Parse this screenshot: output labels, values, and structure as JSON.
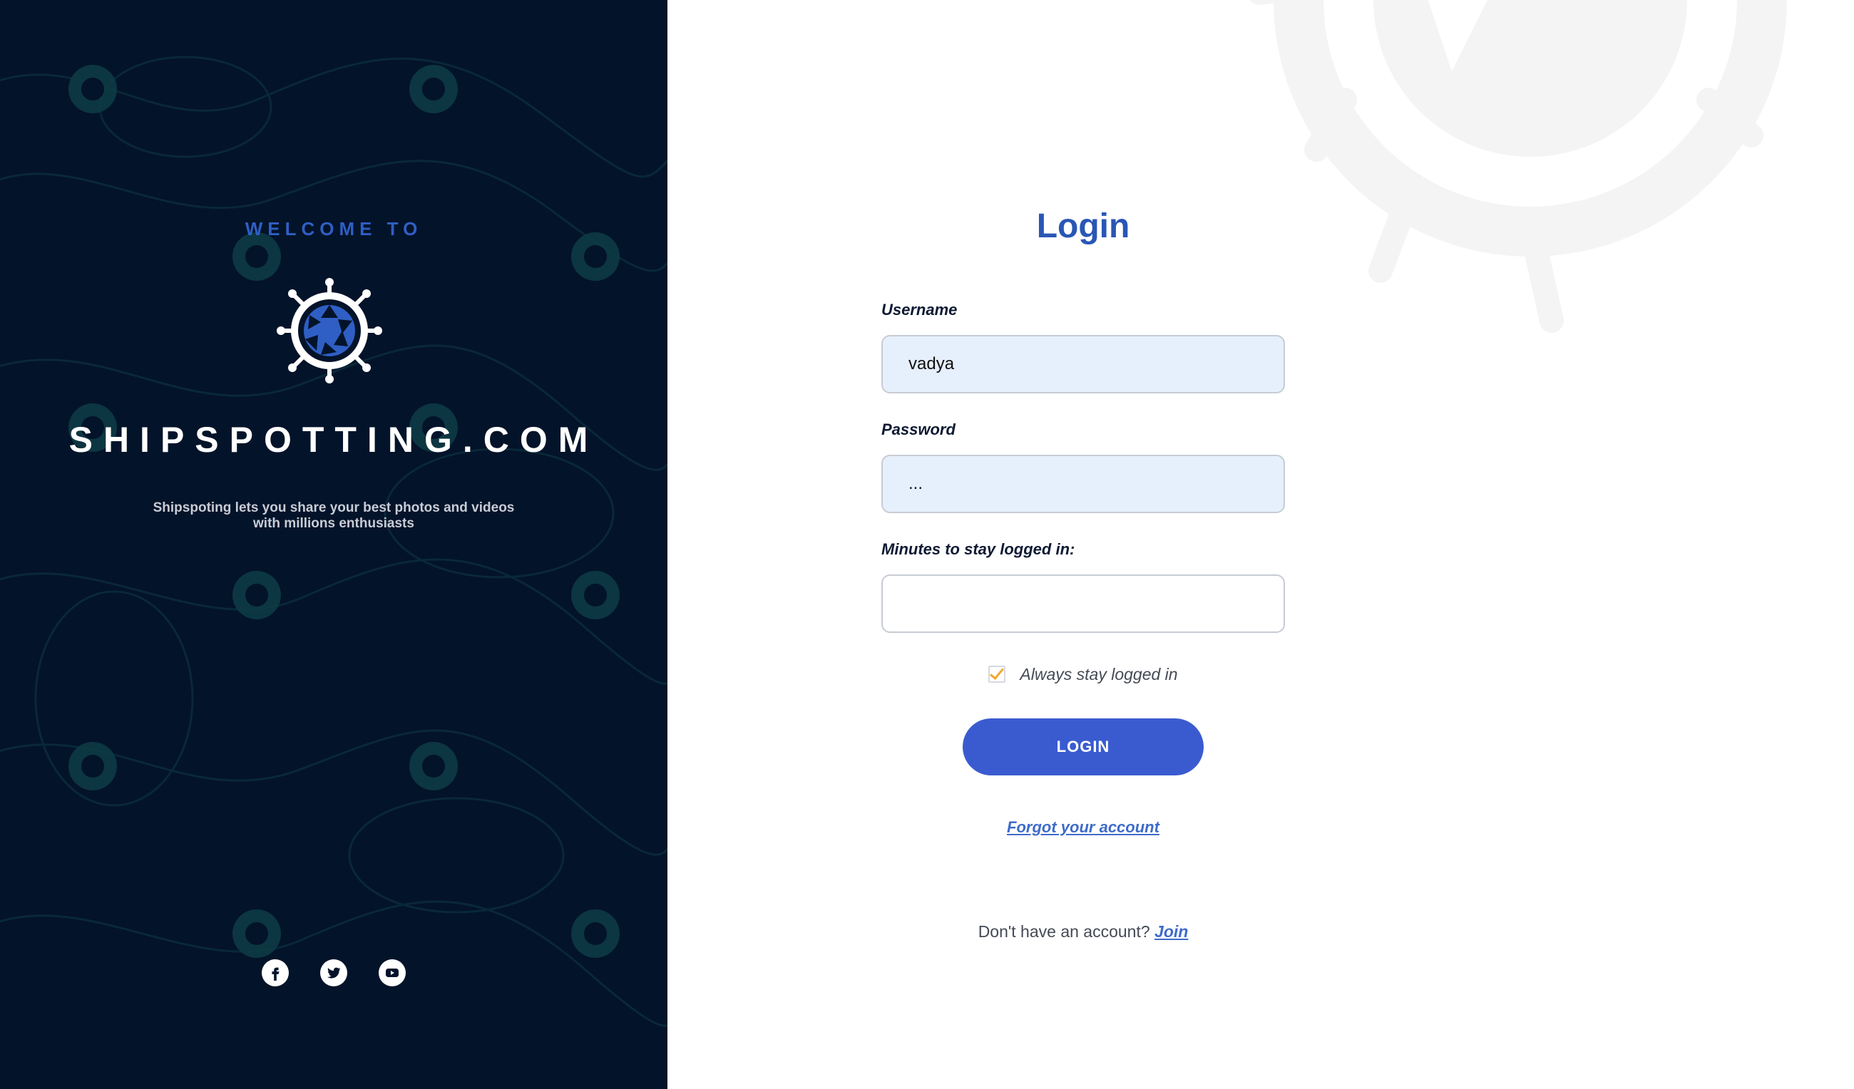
{
  "left_panel": {
    "welcome": "WELCOME TO",
    "brand_name": "SHIPSPOTTING.COM",
    "tagline_line1": "Shipspoting lets you share your best photos and videos",
    "tagline_line2": "with millions enthusiasts",
    "social": [
      {
        "icon": "facebook-icon"
      },
      {
        "icon": "twitter-icon"
      },
      {
        "icon": "youtube-icon"
      }
    ]
  },
  "login_form": {
    "title": "Login",
    "username_label": "Username",
    "username_value": "vadya",
    "password_label": "Password",
    "password_value": "...",
    "minutes_label": "Minutes to stay logged in:",
    "minutes_value": "",
    "always_stay_label": "Always stay logged in",
    "always_stay_checked": true,
    "login_button": "LOGIN",
    "forgot_link": "Forgot your account",
    "no_account_text": "Don't have an account?",
    "join_link": "Join"
  },
  "colors": {
    "left_bg": "#03132a",
    "accent_blue": "#2957b5",
    "button_blue": "#3a5bd0",
    "input_bg": "#e6effc",
    "checkbox_check": "#f0a830"
  }
}
